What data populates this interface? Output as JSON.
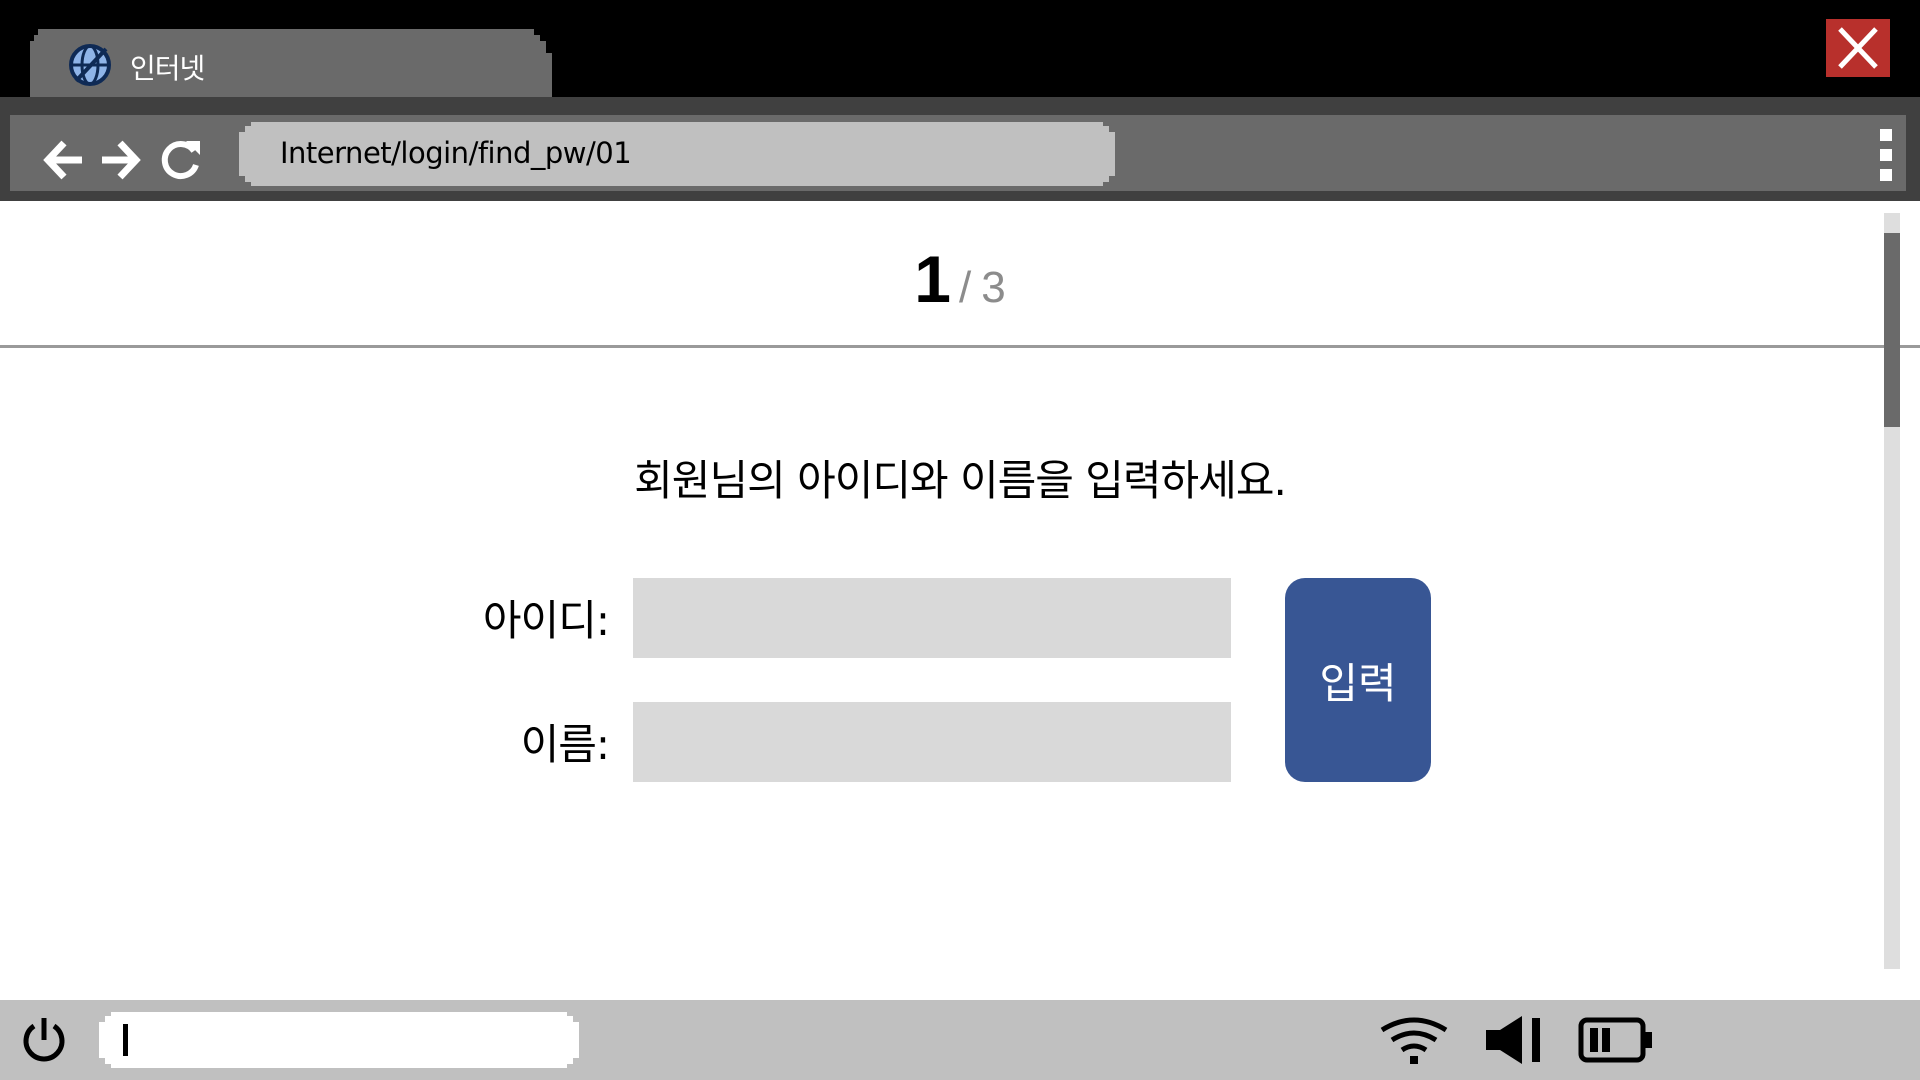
{
  "browser": {
    "tab": {
      "label": "인터넷",
      "icon": "globe-icon"
    },
    "close_icon": "close-icon",
    "nav": {
      "back_icon": "arrow-left-icon",
      "forward_icon": "arrow-right-icon",
      "refresh_icon": "refresh-icon"
    },
    "url": "Internet/login/find_pw/01",
    "menu_icon": "more-vertical-icon"
  },
  "page": {
    "step": {
      "current": "1",
      "separator": "/",
      "total": "3"
    },
    "instruction": "회원님의 아이디와 이름을 입력하세요.",
    "form": {
      "id_label": "아이디:",
      "id_value": "",
      "name_label": "이름:",
      "name_value": "",
      "submit_label": "입력"
    }
  },
  "taskbar": {
    "power_icon": "power-icon",
    "search_value": "",
    "wifi_icon": "wifi-icon",
    "volume_icon": "volume-icon",
    "battery_icon": "battery-icon",
    "battery_level": 0.5
  },
  "colors": {
    "titlebar": "#000000",
    "tab": "#6a6a6a",
    "close": "#b8302c",
    "urlbar": "#c0c0c0",
    "accent": "#385694",
    "input": "#d9d9d9",
    "taskbar": "#c0c0c0"
  }
}
